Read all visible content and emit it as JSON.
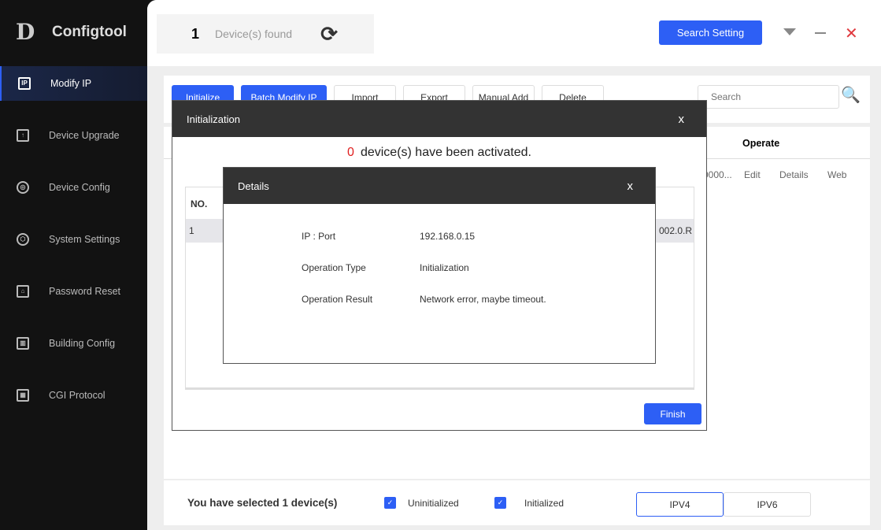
{
  "app": {
    "name": "Configtool",
    "logo_text": "D"
  },
  "sidebar": {
    "items": [
      {
        "label": "Modify IP",
        "icon": "IP",
        "active": true
      },
      {
        "label": "Device Upgrade",
        "icon": "↑"
      },
      {
        "label": "Device Config",
        "icon": "◎"
      },
      {
        "label": "System Settings",
        "icon": "⬡"
      },
      {
        "label": "Password Reset",
        "icon": "⌂"
      },
      {
        "label": "Building Config",
        "icon": "▥"
      },
      {
        "label": "CGI Protocol",
        "icon": "▦"
      }
    ]
  },
  "header": {
    "count": "1",
    "found_label": "Device(s) found",
    "search_setting": "Search Setting"
  },
  "toolbar": {
    "buttons": [
      "Initialize",
      "Batch Modify IP",
      "Import",
      "Export",
      "Manual Add",
      "Delete"
    ],
    "search_placeholder": "Search"
  },
  "table": {
    "operate_header": "Operate",
    "row": {
      "trunc": "0000...",
      "edit": "Edit",
      "details": "Details",
      "web": "Web"
    }
  },
  "init_dialog": {
    "title": "Initialization",
    "close": "x",
    "count": "0",
    "message": "device(s) have been activated.",
    "col_no": "NO.",
    "row_no": "1",
    "row_tail": "002.0.R",
    "finish": "Finish"
  },
  "details_dialog": {
    "title": "Details",
    "close": "x",
    "rows": [
      {
        "label": "IP : Port",
        "value": "192.168.0.15"
      },
      {
        "label": "Operation Type",
        "value": "Initialization"
      },
      {
        "label": "Operation Result",
        "value": "Network error, maybe timeout."
      }
    ]
  },
  "bottom": {
    "selected": "You have selected 1  device(s)",
    "uninit": "Uninitialized",
    "init": "Initialized",
    "ipv4": "IPV4",
    "ipv6": "IPV6"
  }
}
